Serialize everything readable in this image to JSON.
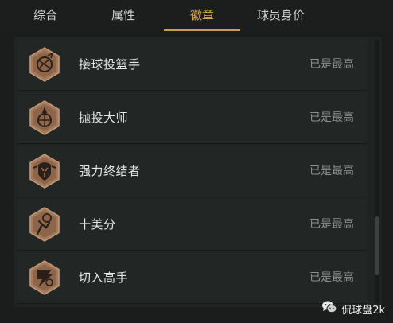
{
  "tabs": [
    {
      "label": "综合",
      "active": false
    },
    {
      "label": "属性",
      "active": false
    },
    {
      "label": "徽章",
      "active": true
    },
    {
      "label": "球员身价",
      "active": false
    }
  ],
  "badges": [
    {
      "name": "接球投篮手",
      "status": "已是最高",
      "icon": "catch-and-shoot-badge-icon"
    },
    {
      "name": "抛投大师",
      "status": "已是最高",
      "icon": "floater-master-badge-icon"
    },
    {
      "name": "强力终结者",
      "status": "已是最高",
      "icon": "power-finisher-badge-icon"
    },
    {
      "name": "十美分",
      "status": "已是最高",
      "icon": "ten-cents-badge-icon"
    },
    {
      "name": "切入高手",
      "status": "已是最高",
      "icon": "slasher-badge-icon"
    }
  ],
  "watermark": {
    "text": "侃球盘2k",
    "icon": "wechat-icon"
  },
  "colors": {
    "accent": "#d7a84a",
    "badge_bronze": "#a47a5c",
    "row_bg": "#222726",
    "status_text": "#8b8f8e"
  }
}
